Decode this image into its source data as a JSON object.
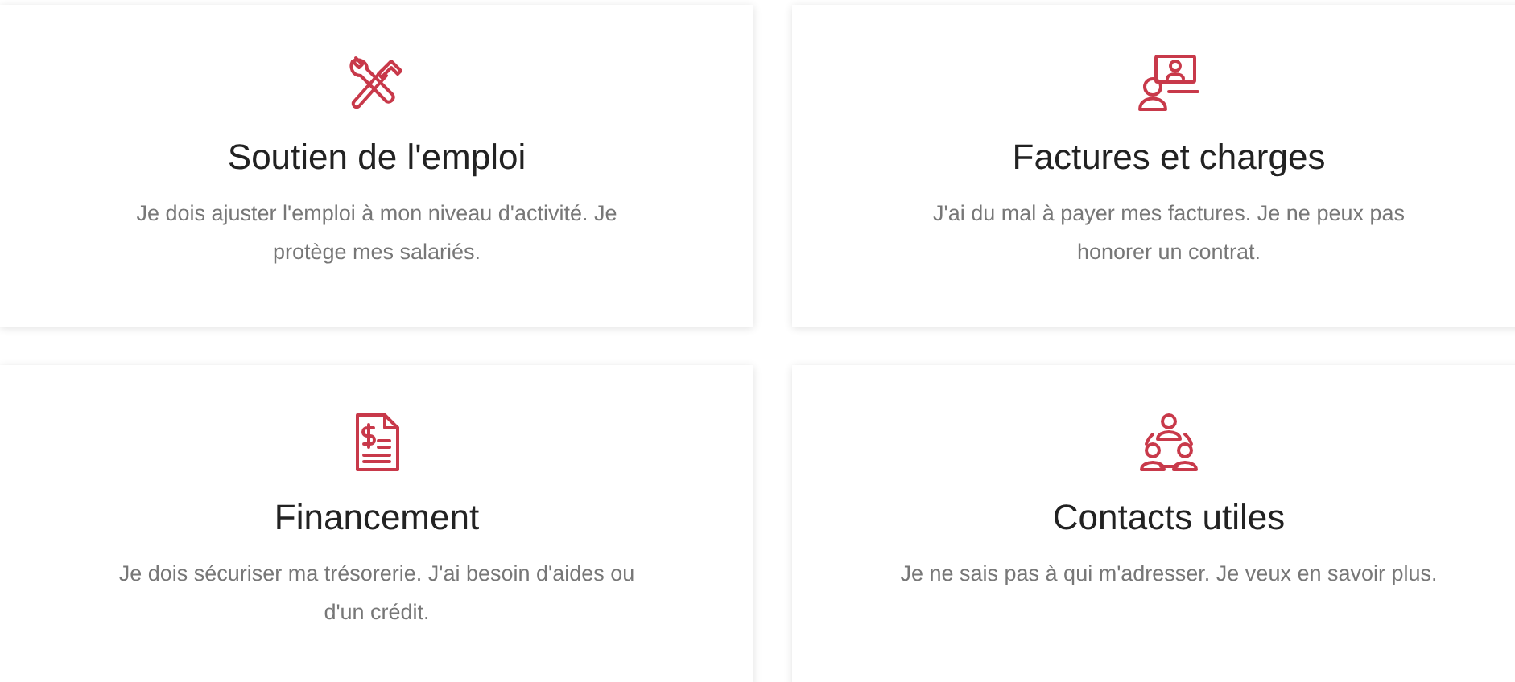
{
  "cards": [
    {
      "title": "Soutien de l'emploi",
      "description": "Je dois ajuster l'emploi à mon niveau d'activité. Je protège mes salariés."
    },
    {
      "title": "Factures et charges",
      "description": "J'ai du mal à payer mes factures. Je ne peux pas honorer un contrat."
    },
    {
      "title": "Financement",
      "description": "Je dois sécuriser ma trésorerie. J'ai besoin d'aides ou d'un crédit."
    },
    {
      "title": "Contacts utiles",
      "description": "Je ne sais pas à qui m'adresser. Je veux en savoir plus."
    }
  ]
}
